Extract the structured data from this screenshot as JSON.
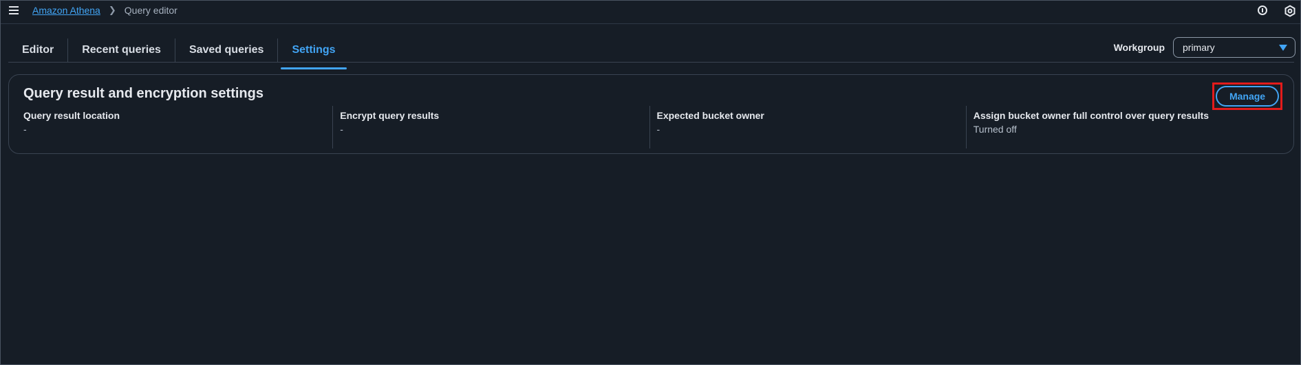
{
  "topbar": {
    "breadcrumb_link": "Amazon Athena",
    "breadcrumb_current": "Query editor"
  },
  "tabs": [
    {
      "label": "Editor"
    },
    {
      "label": "Recent queries"
    },
    {
      "label": "Saved queries"
    },
    {
      "label": "Settings"
    }
  ],
  "workgroup": {
    "label": "Workgroup",
    "selected": "primary"
  },
  "card": {
    "title": "Query result and encryption settings",
    "manage_label": "Manage",
    "fields": [
      {
        "label": "Query result location",
        "value": "-"
      },
      {
        "label": "Encrypt query results",
        "value": "-"
      },
      {
        "label": "Expected bucket owner",
        "value": "-"
      },
      {
        "label": "Assign bucket owner full control over query results",
        "value": "Turned off"
      }
    ]
  },
  "colors": {
    "background": "#161d26",
    "accent": "#42a5f5",
    "highlight": "#e31b1b"
  }
}
